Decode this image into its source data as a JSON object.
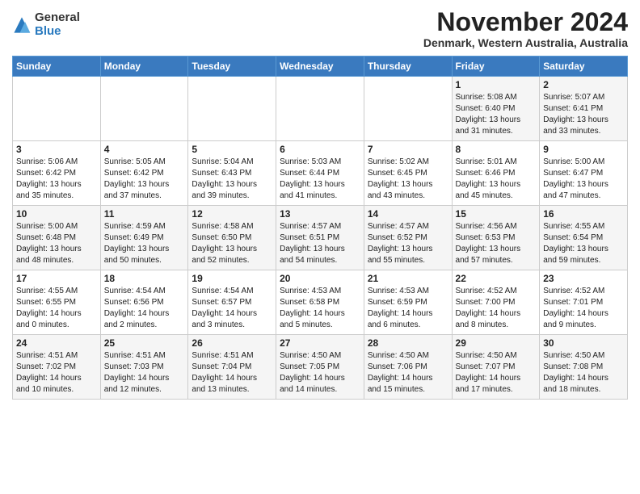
{
  "header": {
    "logo_general": "General",
    "logo_blue": "Blue",
    "main_title": "November 2024",
    "subtitle": "Denmark, Western Australia, Australia"
  },
  "calendar": {
    "days_of_week": [
      "Sunday",
      "Monday",
      "Tuesday",
      "Wednesday",
      "Thursday",
      "Friday",
      "Saturday"
    ],
    "weeks": [
      [
        {
          "day": "",
          "info": ""
        },
        {
          "day": "",
          "info": ""
        },
        {
          "day": "",
          "info": ""
        },
        {
          "day": "",
          "info": ""
        },
        {
          "day": "",
          "info": ""
        },
        {
          "day": "1",
          "info": "Sunrise: 5:08 AM\nSunset: 6:40 PM\nDaylight: 13 hours\nand 31 minutes."
        },
        {
          "day": "2",
          "info": "Sunrise: 5:07 AM\nSunset: 6:41 PM\nDaylight: 13 hours\nand 33 minutes."
        }
      ],
      [
        {
          "day": "3",
          "info": "Sunrise: 5:06 AM\nSunset: 6:42 PM\nDaylight: 13 hours\nand 35 minutes."
        },
        {
          "day": "4",
          "info": "Sunrise: 5:05 AM\nSunset: 6:42 PM\nDaylight: 13 hours\nand 37 minutes."
        },
        {
          "day": "5",
          "info": "Sunrise: 5:04 AM\nSunset: 6:43 PM\nDaylight: 13 hours\nand 39 minutes."
        },
        {
          "day": "6",
          "info": "Sunrise: 5:03 AM\nSunset: 6:44 PM\nDaylight: 13 hours\nand 41 minutes."
        },
        {
          "day": "7",
          "info": "Sunrise: 5:02 AM\nSunset: 6:45 PM\nDaylight: 13 hours\nand 43 minutes."
        },
        {
          "day": "8",
          "info": "Sunrise: 5:01 AM\nSunset: 6:46 PM\nDaylight: 13 hours\nand 45 minutes."
        },
        {
          "day": "9",
          "info": "Sunrise: 5:00 AM\nSunset: 6:47 PM\nDaylight: 13 hours\nand 47 minutes."
        }
      ],
      [
        {
          "day": "10",
          "info": "Sunrise: 5:00 AM\nSunset: 6:48 PM\nDaylight: 13 hours\nand 48 minutes."
        },
        {
          "day": "11",
          "info": "Sunrise: 4:59 AM\nSunset: 6:49 PM\nDaylight: 13 hours\nand 50 minutes."
        },
        {
          "day": "12",
          "info": "Sunrise: 4:58 AM\nSunset: 6:50 PM\nDaylight: 13 hours\nand 52 minutes."
        },
        {
          "day": "13",
          "info": "Sunrise: 4:57 AM\nSunset: 6:51 PM\nDaylight: 13 hours\nand 54 minutes."
        },
        {
          "day": "14",
          "info": "Sunrise: 4:57 AM\nSunset: 6:52 PM\nDaylight: 13 hours\nand 55 minutes."
        },
        {
          "day": "15",
          "info": "Sunrise: 4:56 AM\nSunset: 6:53 PM\nDaylight: 13 hours\nand 57 minutes."
        },
        {
          "day": "16",
          "info": "Sunrise: 4:55 AM\nSunset: 6:54 PM\nDaylight: 13 hours\nand 59 minutes."
        }
      ],
      [
        {
          "day": "17",
          "info": "Sunrise: 4:55 AM\nSunset: 6:55 PM\nDaylight: 14 hours\nand 0 minutes."
        },
        {
          "day": "18",
          "info": "Sunrise: 4:54 AM\nSunset: 6:56 PM\nDaylight: 14 hours\nand 2 minutes."
        },
        {
          "day": "19",
          "info": "Sunrise: 4:54 AM\nSunset: 6:57 PM\nDaylight: 14 hours\nand 3 minutes."
        },
        {
          "day": "20",
          "info": "Sunrise: 4:53 AM\nSunset: 6:58 PM\nDaylight: 14 hours\nand 5 minutes."
        },
        {
          "day": "21",
          "info": "Sunrise: 4:53 AM\nSunset: 6:59 PM\nDaylight: 14 hours\nand 6 minutes."
        },
        {
          "day": "22",
          "info": "Sunrise: 4:52 AM\nSunset: 7:00 PM\nDaylight: 14 hours\nand 8 minutes."
        },
        {
          "day": "23",
          "info": "Sunrise: 4:52 AM\nSunset: 7:01 PM\nDaylight: 14 hours\nand 9 minutes."
        }
      ],
      [
        {
          "day": "24",
          "info": "Sunrise: 4:51 AM\nSunset: 7:02 PM\nDaylight: 14 hours\nand 10 minutes."
        },
        {
          "day": "25",
          "info": "Sunrise: 4:51 AM\nSunset: 7:03 PM\nDaylight: 14 hours\nand 12 minutes."
        },
        {
          "day": "26",
          "info": "Sunrise: 4:51 AM\nSunset: 7:04 PM\nDaylight: 14 hours\nand 13 minutes."
        },
        {
          "day": "27",
          "info": "Sunrise: 4:50 AM\nSunset: 7:05 PM\nDaylight: 14 hours\nand 14 minutes."
        },
        {
          "day": "28",
          "info": "Sunrise: 4:50 AM\nSunset: 7:06 PM\nDaylight: 14 hours\nand 15 minutes."
        },
        {
          "day": "29",
          "info": "Sunrise: 4:50 AM\nSunset: 7:07 PM\nDaylight: 14 hours\nand 17 minutes."
        },
        {
          "day": "30",
          "info": "Sunrise: 4:50 AM\nSunset: 7:08 PM\nDaylight: 14 hours\nand 18 minutes."
        }
      ]
    ]
  }
}
